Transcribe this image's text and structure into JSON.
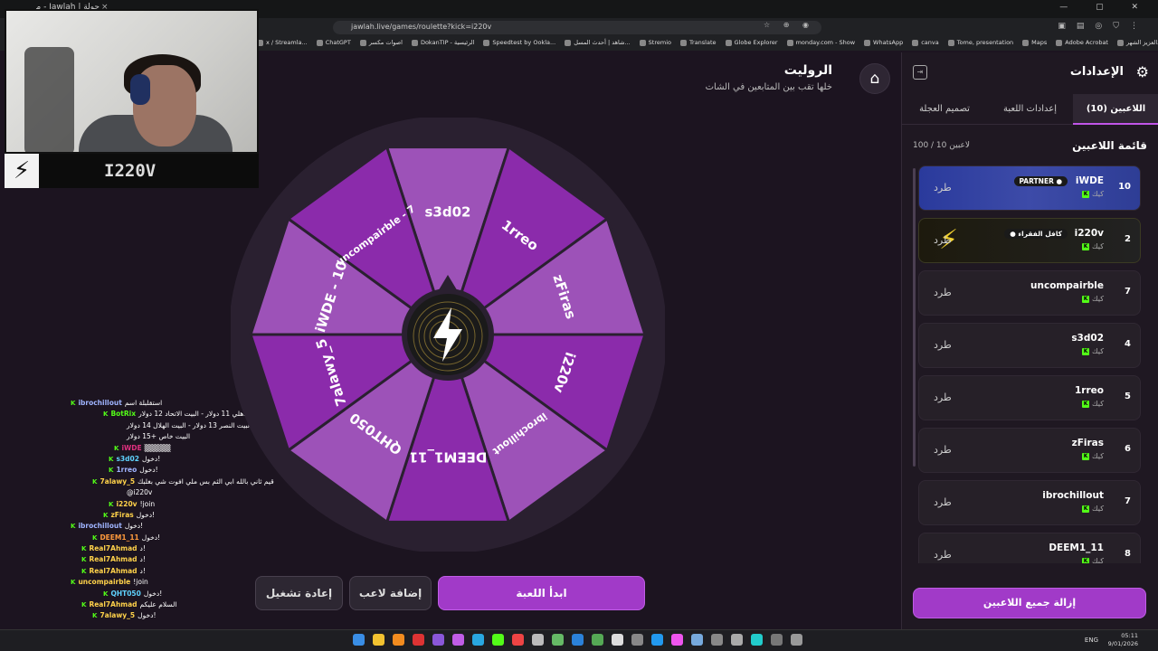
{
  "browser": {
    "tab_title": "جولة | Jawlah - منصة الألعاب",
    "tab_close": "×",
    "url": "jawlah.live/games/roulette?kick=i220v",
    "window_controls": "—  ▢  ✕",
    "bookmarks": [
      "x / Streamla...",
      "ChatGPT",
      "اصوات مكسر",
      "DokanTIP - الرئيسية",
      "Speedtest by Ookla...",
      "شاهد | أحدث المسل...",
      "Stremio",
      "Translate",
      "Globe Explorer",
      "monday.com - Show",
      "WhatsApp",
      "canva",
      "Tome, presentation",
      "Maps",
      "Adobe Acrobat",
      "البث عبدالعزيز الشهر..."
    ]
  },
  "webcam": {
    "streamer_name": "I220V"
  },
  "chat": [
    {
      "user": "ibrochillout",
      "color": "#9fb4ff",
      "msg": "استقلبلة اسم"
    },
    {
      "user": "BotRix",
      "color": "#53fc18",
      "msg": "البيت الأهلي 11 دولار - البيت الاتحاد 12 دولار"
    },
    {
      "user": "",
      "color": "#fff",
      "msg": "البيت النصر 13 دولار - البيت الهلال 14 دولار -"
    },
    {
      "user": "",
      "color": "#fff",
      "msg": "البيت خاص +15 دولار"
    },
    {
      "user": "iWDE",
      "color": "#e0307f",
      "msg": "▒▒▒▒▒"
    },
    {
      "user": "s3d02",
      "color": "#5fd3ff",
      "msg": "دخول!"
    },
    {
      "user": "1rreo",
      "color": "#9fb4ff",
      "msg": "دخول!"
    },
    {
      "user": "7alawy_5",
      "color": "#ffd24a",
      "msg": "قيم ثاني بالله ابي الثم بس ملي افوت شي بغلبك"
    },
    {
      "user": "",
      "color": "#fff",
      "msg": "@i220v"
    },
    {
      "user": "i220v",
      "color": "#ffd24a",
      "msg": "!join"
    },
    {
      "user": "zFiras",
      "color": "#ffd24a",
      "msg": "دخول!"
    },
    {
      "user": "ibrochillout",
      "color": "#9fb4ff",
      "msg": "دخول!"
    },
    {
      "user": "DEEM1_11",
      "color": "#ff9a3c",
      "msg": "دخول!"
    },
    {
      "user": "Real7Ahmad",
      "color": "#ffd24a",
      "msg": "د!"
    },
    {
      "user": "Real7Ahmad",
      "color": "#ffd24a",
      "msg": "د!"
    },
    {
      "user": "Real7Ahmad",
      "color": "#ffd24a",
      "msg": "د!"
    },
    {
      "user": "uncompairble",
      "color": "#ffd24a",
      "msg": "!join"
    },
    {
      "user": "QHT050",
      "color": "#5fd3ff",
      "msg": "دخول!"
    },
    {
      "user": "Real7Ahmad",
      "color": "#ffd24a",
      "msg": "السلام عليكم"
    },
    {
      "user": "7alawy_5",
      "color": "#ffd24a",
      "msg": "دخول!"
    }
  ],
  "roulette": {
    "title": "الروليت",
    "subtitle": "خلها تقب بين المتابعين في الشات",
    "wheel_segments": [
      "s3d02",
      "1rreo",
      "zFiras",
      "i220v",
      "ibrochillout",
      "DEEM1_11",
      "QHT050",
      "7alawy_5",
      "iWDE - 10",
      "uncompairble - 7"
    ],
    "segment_colors": [
      "#9d52b8",
      "#8b2bab"
    ],
    "start_label": "ابدأ اللعبة",
    "add_player_label": "إضافة لاعب",
    "replay_label": "إعادة تشغيل"
  },
  "settings": {
    "title": "الإعدادات",
    "tabs": {
      "players": "اللاعبين (10)",
      "game_settings": "إعدادات اللعبة",
      "wheel_design": "تصميم العجلة"
    },
    "players_heading": "قائمة اللاعبين",
    "players_count": "100 / 10 لاعبين",
    "kick_label": "طرد",
    "platform_label": "كيك",
    "players": [
      {
        "name": "iWDE",
        "count": "10",
        "badge": "PARTNER ●",
        "style": "partner"
      },
      {
        "name": "i220v",
        "count": "2",
        "badge": "● كافل الفقراء",
        "style": "owner"
      },
      {
        "name": "uncompairble",
        "count": "7",
        "badge": "",
        "style": ""
      },
      {
        "name": "s3d02",
        "count": "4",
        "badge": "",
        "style": ""
      },
      {
        "name": "1rreo",
        "count": "5",
        "badge": "",
        "style": ""
      },
      {
        "name": "zFiras",
        "count": "6",
        "badge": "",
        "style": ""
      },
      {
        "name": "ibrochillout",
        "count": "7",
        "badge": "",
        "style": ""
      },
      {
        "name": "DEEM1_11",
        "count": "8",
        "badge": "",
        "style": ""
      }
    ],
    "remove_all_label": "إزالة جميع اللاعبين"
  },
  "taskbar": {
    "lang": "ENG",
    "time": "05:11",
    "date": "9/01/2026"
  }
}
